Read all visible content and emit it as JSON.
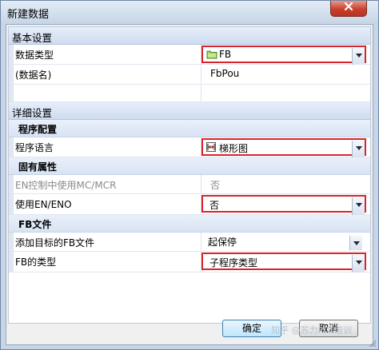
{
  "window": {
    "title": "新建数据"
  },
  "grid": {
    "section_basic": "基本设置",
    "data_type": {
      "label": "数据类型",
      "value": "FB",
      "icon": "folder-icon"
    },
    "data_name": {
      "label": "(数据名)",
      "value": "FbPou"
    },
    "section_detail": "详细设置",
    "sub_program": "程序配置",
    "prog_lang": {
      "label": "程序语言",
      "value": "梯形图",
      "icon": "ladder-icon"
    },
    "sub_inherent": "固有属性",
    "en_mc_mcr": {
      "label": "EN控制中使用MC/MCR",
      "value": "否"
    },
    "use_en_eno": {
      "label": "使用EN/ENO",
      "value": "否"
    },
    "sub_fb_file": "FB文件",
    "add_target": {
      "label": "添加目标的FB文件",
      "value": "起保停"
    },
    "fb_type": {
      "label": "FB的类型",
      "value": "子程序类型"
    }
  },
  "buttons": {
    "ok": "确定",
    "cancel": "取消"
  },
  "watermark": "知乎 @苏力PLC培训",
  "colors": {
    "highlight_border": "#d8242b",
    "section_bg": "#dce6f5"
  }
}
